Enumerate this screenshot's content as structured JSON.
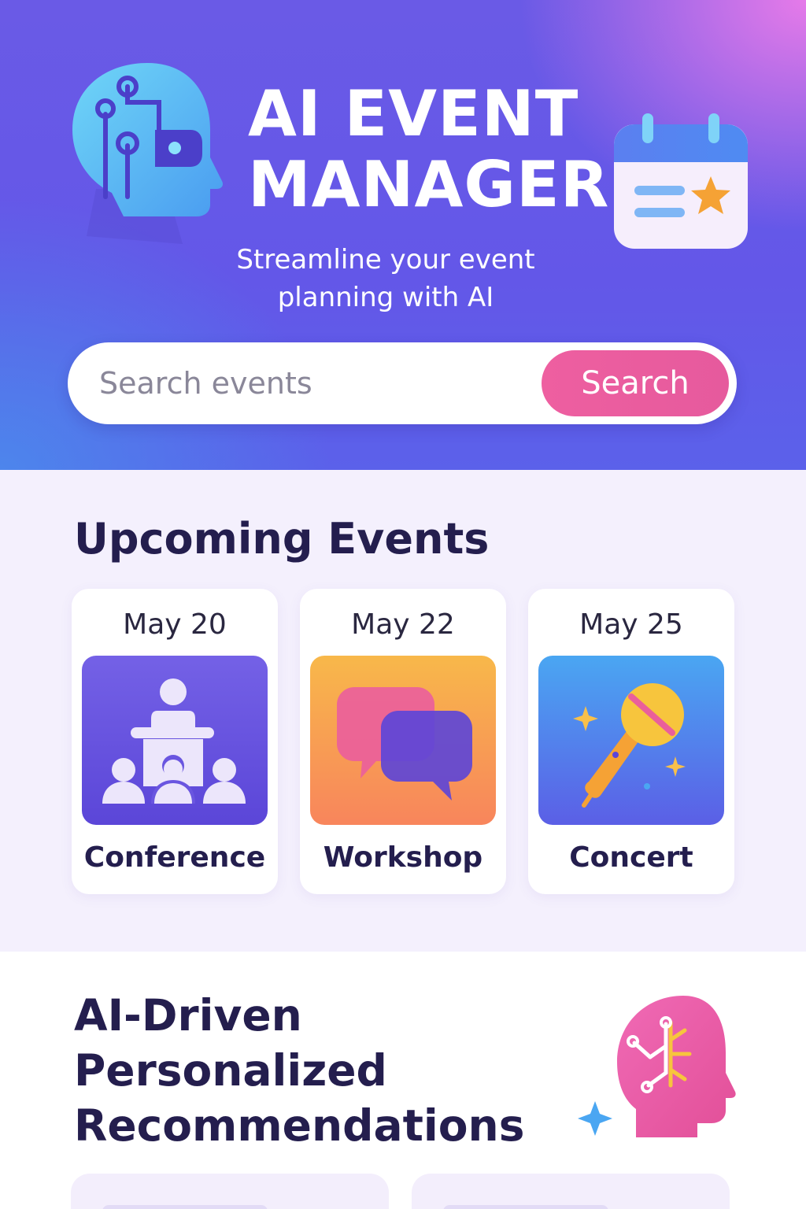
{
  "hero": {
    "title": "AI EVENT MANAGER",
    "subtitle": "Streamline your event planning with AI",
    "search": {
      "placeholder": "Search events",
      "value": "",
      "button_label": "Search"
    }
  },
  "upcoming": {
    "title": "Upcoming Events",
    "events": [
      {
        "date": "May 20",
        "label": "Conference",
        "icon": "conference-icon"
      },
      {
        "date": "May 22",
        "label": "Workshop",
        "icon": "chat-bubbles-icon"
      },
      {
        "date": "May 25",
        "label": "Concert",
        "icon": "microphone-icon"
      }
    ]
  },
  "recommendations": {
    "title": "AI-Driven Personalized Recommendations",
    "icon": "ai-brain-icon"
  },
  "colors": {
    "accent": "#e65a9d",
    "primary": "#6357e8",
    "heading": "#241e4e"
  }
}
